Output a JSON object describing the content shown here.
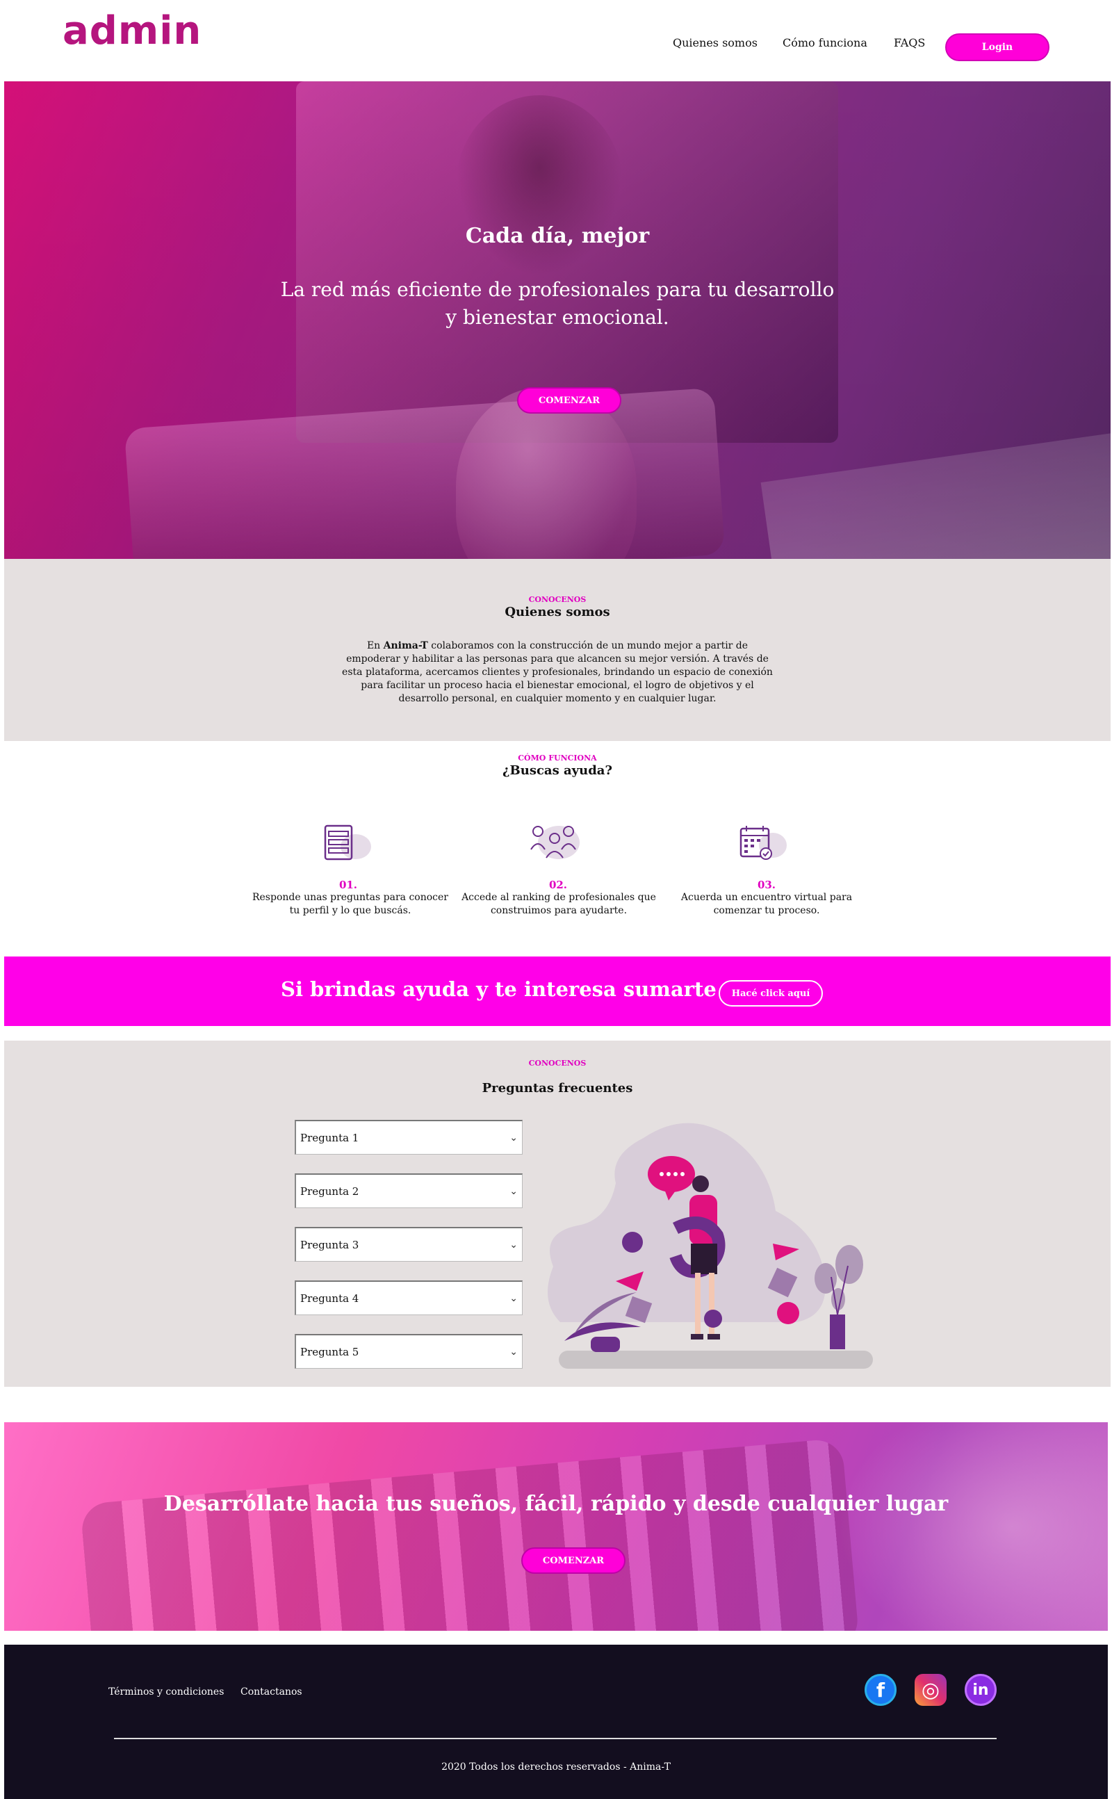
{
  "header": {
    "logo": "admin",
    "nav": [
      "Quienes somos",
      "Cómo funciona",
      "FAQS"
    ],
    "login": "Login"
  },
  "hero": {
    "title": "Cada día, mejor",
    "subtitle": "La red más eficiente de profesionales para tu desarrollo y bienestar emocional.",
    "cta": "COMENZAR"
  },
  "about": {
    "kicker": "CONOCENOS",
    "title": "Quienes somos",
    "text_pre": "En ",
    "brand": "Anima-T",
    "text_post": " colaboramos con la construcción de un mundo mejor a partir de empoderar y habilitar a las personas para que alcancen su mejor versión. A través de esta plataforma, acercamos clientes y profesionales, brindando un espacio de conexión para facilitar un proceso hacia el bienestar emocional, el logro de objetivos y el desarrollo personal, en cualquier momento y en cualquier lugar."
  },
  "how": {
    "kicker": "CÓMO FUNCIONA",
    "title": "¿Buscas ayuda?",
    "steps": [
      {
        "num": "01.",
        "text": "Responde unas preguntas para conocer tu perfil y lo que buscás.",
        "icon": "form-icon"
      },
      {
        "num": "02.",
        "text": "Accede al ranking de profesionales que construimos para ayudarte.",
        "icon": "team-icon"
      },
      {
        "num": "03.",
        "text": "Acuerda un encuentro virtual para comenzar tu proceso.",
        "icon": "calendar-icon"
      }
    ]
  },
  "banner": {
    "text": "Si brindas ayuda y te interesa sumarte",
    "button": "Hacé click aquí"
  },
  "faq": {
    "kicker": "CONOCENOS",
    "title": "Preguntas frecuentes",
    "questions": [
      "Pregunta 1",
      "Pregunta 2",
      "Pregunta 3",
      "Pregunta 4",
      "Pregunta 5"
    ],
    "bubble": "••••"
  },
  "cta2": {
    "title": "Desarróllate hacia tus sueños, fácil, rápido y desde cualquier lugar",
    "button": "COMENZAR"
  },
  "footer": {
    "links": [
      "Términos y condiciones",
      "Contactanos"
    ],
    "social": [
      {
        "icon": "facebook-icon",
        "glyph": "f",
        "color": "#1877f2"
      },
      {
        "icon": "instagram-icon",
        "glyph": "◎",
        "color": "#e1306c"
      },
      {
        "icon": "linkedin-icon",
        "glyph": "in",
        "color": "#8a2be2"
      }
    ],
    "copyright": "2020 Todos los derechos reservados - Anima-T"
  },
  "colors": {
    "accent": "#ff00d8",
    "brand": "#b5157e",
    "footer_bg": "#130e1f",
    "section_gray": "#e5e0e0"
  }
}
